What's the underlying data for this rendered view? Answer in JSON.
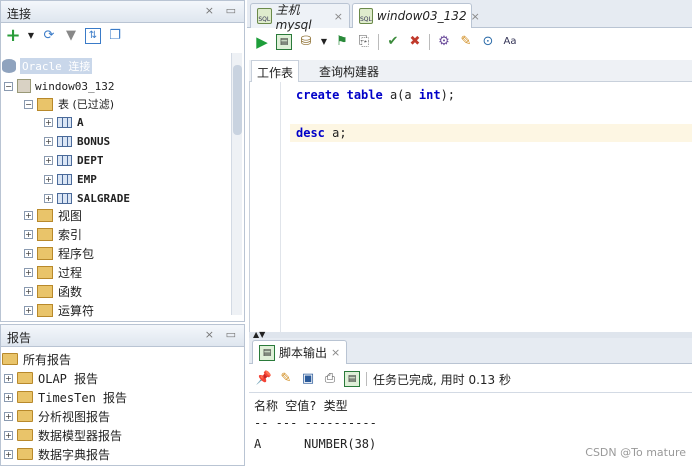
{
  "connections_panel": {
    "title": "连接",
    "toolbar_icons": [
      "add-connection-icon",
      "chevron-down-icon",
      "refresh-icon",
      "filter-icon",
      "schema-browser-icon",
      "new-window-icon"
    ],
    "root_label": "Oracle 连接",
    "connection": "window03_132",
    "tables_node": "表 (已过滤)",
    "tables": [
      "A",
      "BONUS",
      "DEPT",
      "EMP",
      "SALGRADE"
    ],
    "nodes": [
      "视图",
      "索引",
      "程序包",
      "过程",
      "函数",
      "运算符"
    ]
  },
  "reports_panel": {
    "title": "报告",
    "root": "所有报告",
    "items": [
      "OLAP 报告",
      "TimesTen 报告",
      "分析视图报告",
      "数据模型器报告",
      "数据字典报告"
    ]
  },
  "editor": {
    "tabs": [
      {
        "label": "主机mysql",
        "close": "×"
      },
      {
        "label": "window03_132",
        "close": "×"
      }
    ],
    "subtabs": [
      "工作表",
      "查询构建器"
    ],
    "code": [
      [
        "create",
        "table",
        "a(a",
        "int",
        ");"
      ],
      [
        "desc",
        "a;"
      ]
    ]
  },
  "output": {
    "tab_label": "脚本输出",
    "tab_close": "×",
    "status": "任务已完成, 用时 0.13 秒",
    "header": "名称 空值? 类型",
    "separator": "-- --- ----------",
    "row_name": "A",
    "row_type": "NUMBER(38)"
  },
  "watermark": "CSDN @To mature",
  "colors": {
    "accent": "#2f5f9e",
    "current_line": "#fdf6e3"
  }
}
